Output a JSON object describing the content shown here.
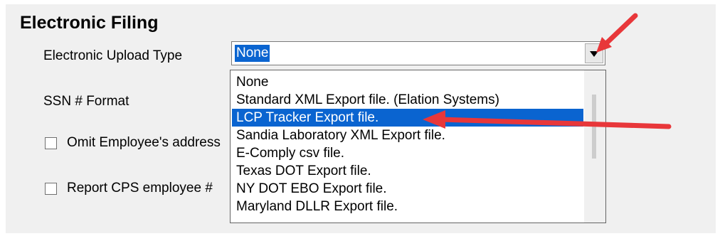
{
  "section": {
    "title": "Electronic Filing"
  },
  "labels": {
    "upload_type": "Electronic Upload Type",
    "ssn_format": "SSN # Format",
    "omit_address": "Omit Employee's address",
    "report_cps": "Report CPS employee #"
  },
  "combo": {
    "value": "None",
    "options": [
      "None",
      "Standard XML Export file. (Elation Systems)",
      "LCP Tracker Export file.",
      "Sandia Laboratory XML Export file.",
      "E-Comply csv file.",
      "Texas DOT Export file.",
      "NY DOT EBO Export file.",
      "Maryland DLLR Export file."
    ],
    "highlighted_index": 2
  },
  "colors": {
    "highlight": "#0a64d0",
    "annotation_arrow": "#e8373a",
    "panel": "#f0f0f0"
  },
  "icons": {
    "dropdown": "chevron-down-icon",
    "annotation": "red-arrow-icon"
  }
}
